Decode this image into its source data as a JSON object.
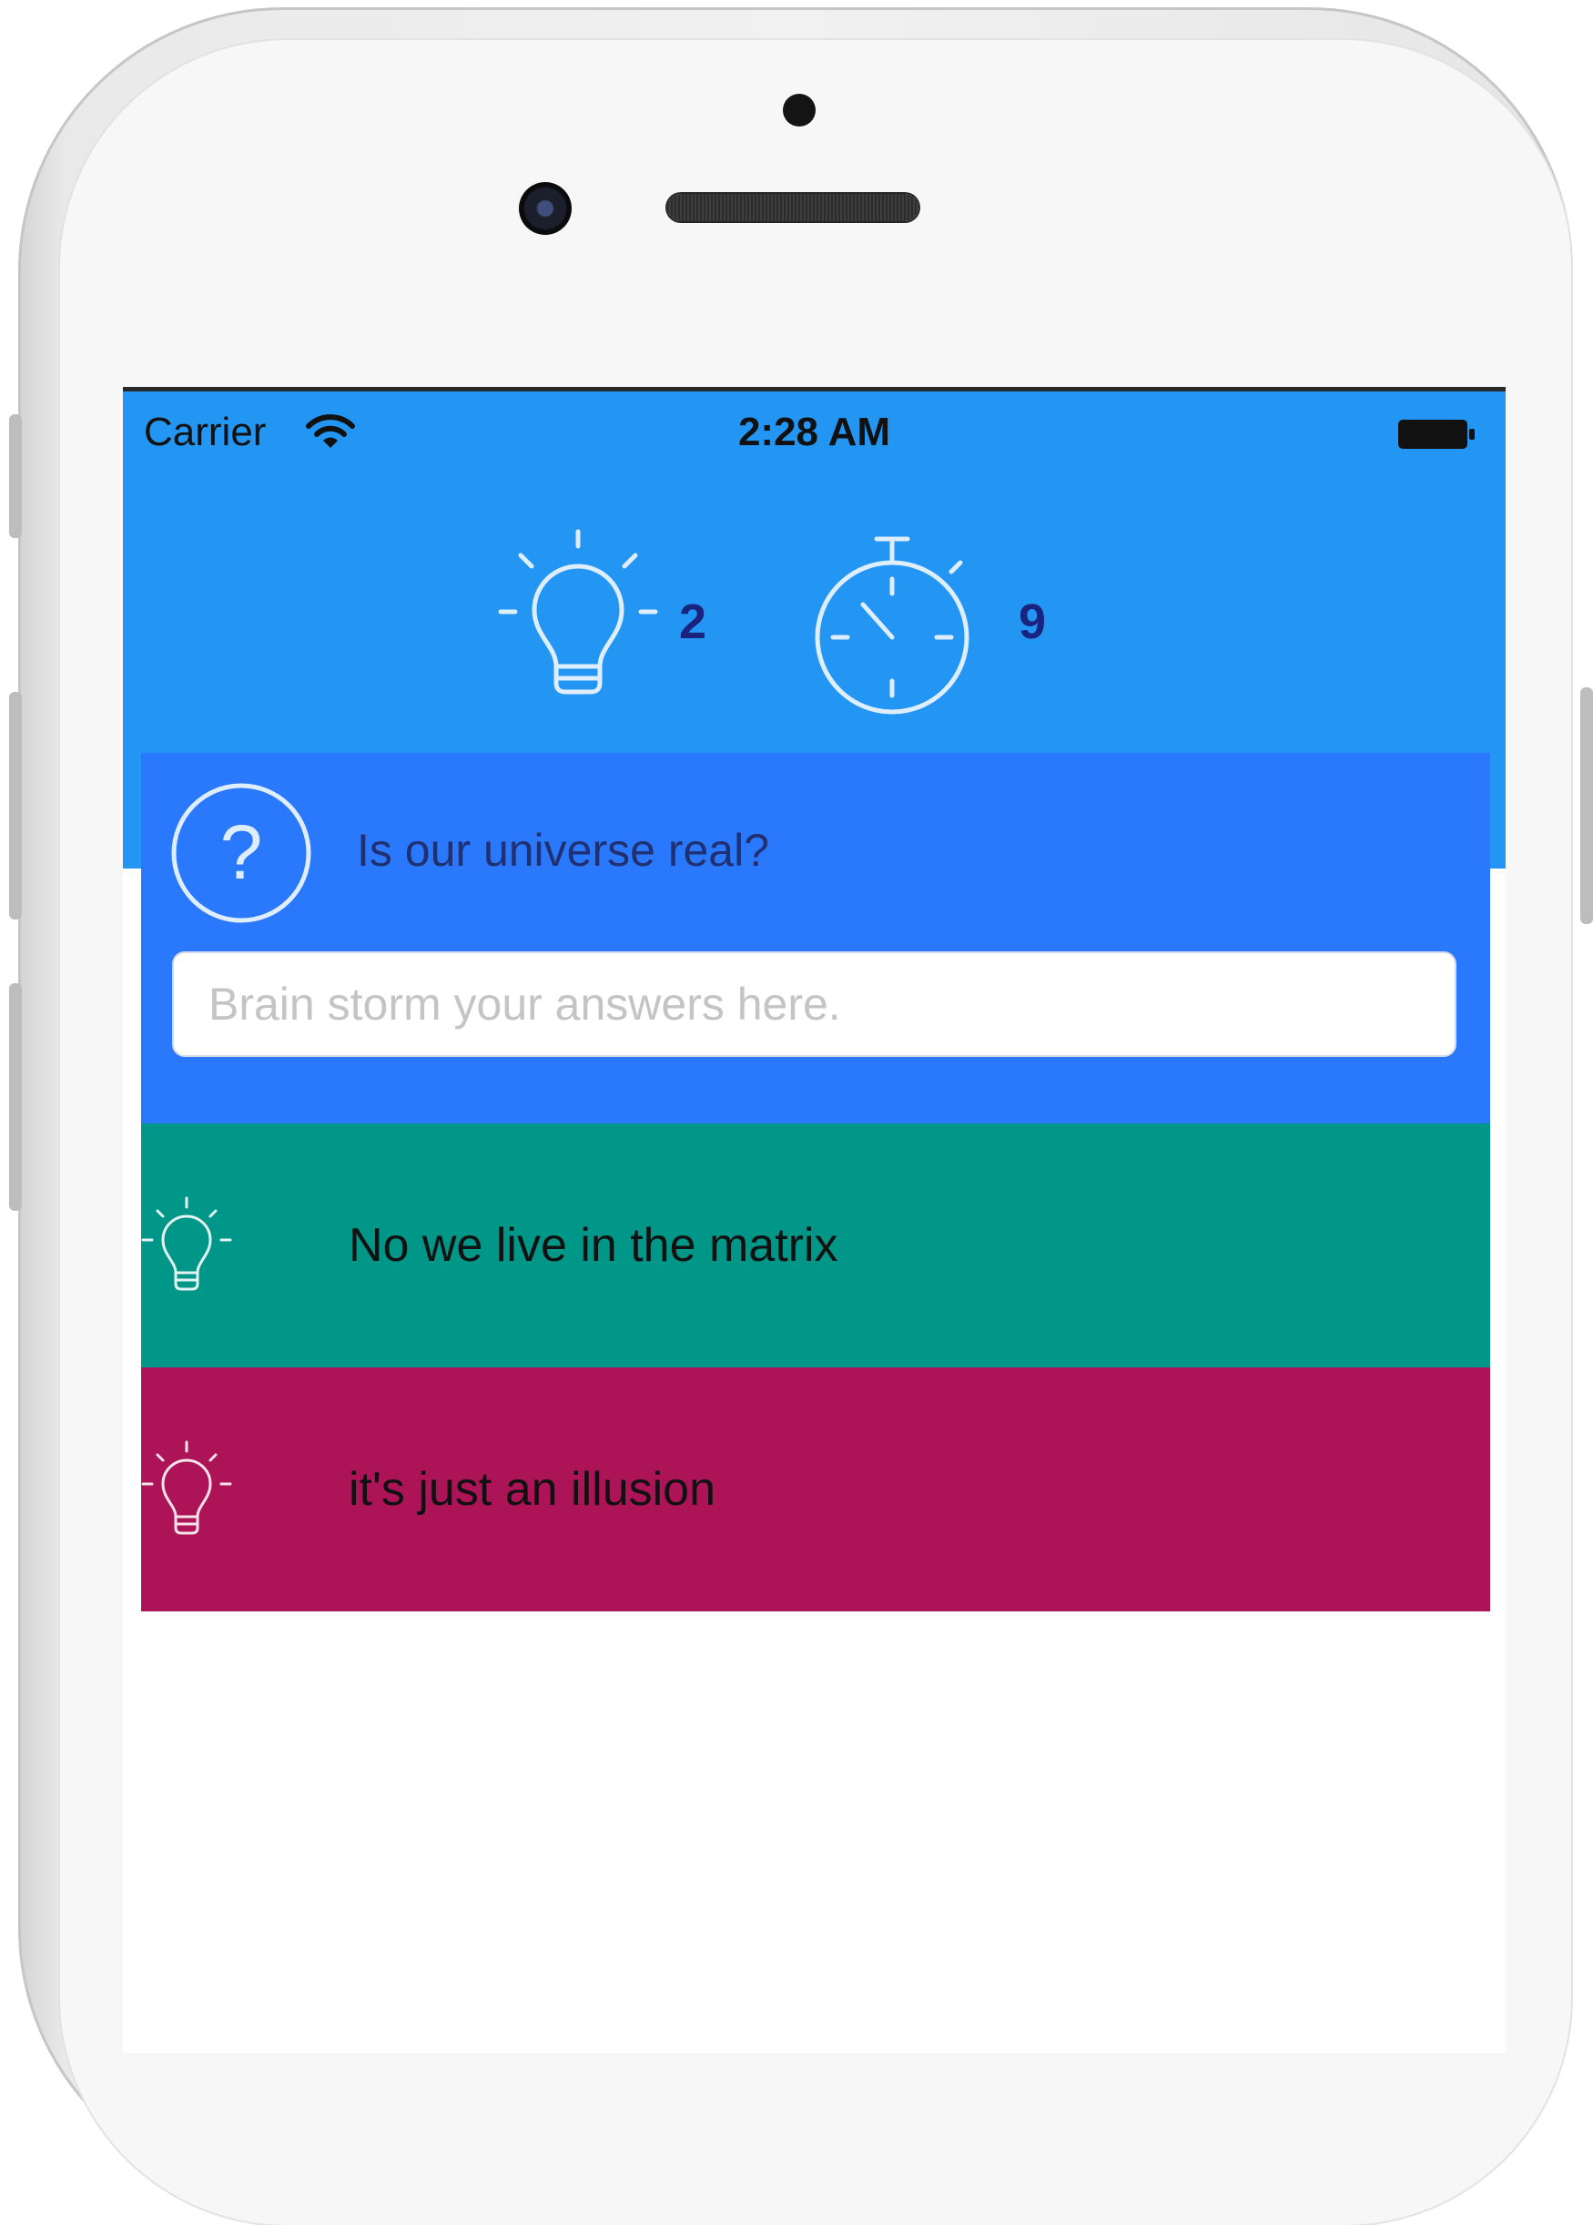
{
  "status_bar": {
    "carrier": "Carrier",
    "time": "2:28 AM",
    "wifi_icon": "wifi-icon",
    "battery_icon": "battery-full-icon"
  },
  "stats": {
    "ideas_icon": "lightbulb-icon",
    "ideas_count": "2",
    "timer_icon": "stopwatch-icon",
    "timer_value": "9"
  },
  "question": {
    "icon": "question-mark-icon",
    "text": "Is our universe real?",
    "input_placeholder": "Brain storm your answers here.",
    "input_value": ""
  },
  "answers": [
    {
      "text": "No we live in the matrix",
      "icon": "lightbulb-icon",
      "color": "#009688"
    },
    {
      "text": "it's just an illusion",
      "icon": "lightbulb-icon",
      "color": "#ad1457"
    }
  ],
  "colors": {
    "header": "#2396f3",
    "question_card": "#2a79fd",
    "stat_text": "#1a237e"
  }
}
